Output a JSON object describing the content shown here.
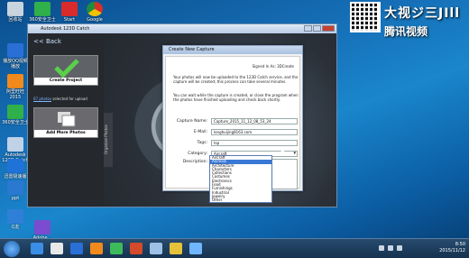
{
  "desktop": {
    "icons": [
      {
        "label": "回收站",
        "color": "#c9d4de"
      },
      {
        "label": "360安全卫士",
        "color": "#2fb04a"
      },
      {
        "label": "Start",
        "color": "#d92b2b"
      },
      {
        "label": "Google",
        "color": "#f2c200"
      },
      {
        "label": "播放QQ视频播放",
        "color": "#2a6fd6"
      },
      {
        "label": "阿里旺旺2015",
        "color": "#f08a1c"
      },
      {
        "label": "360安全卫士",
        "color": "#2fb04a"
      },
      {
        "label": "Autodesk 123D Catch",
        "color": "#c0d2e6"
      },
      {
        "label": "迅雷极速版",
        "color": "#1f73d8"
      },
      {
        "label": "ppt",
        "color": "#2a78d0"
      },
      {
        "label": "Q友",
        "color": "#2f7fd8"
      },
      {
        "label": "Adobe...",
        "color": "#7b4bd0"
      }
    ]
  },
  "brand": {
    "line1": "大视ジ三JIll",
    "line2": "腾讯视频"
  },
  "app": {
    "title": "Autodesk 123D Catch",
    "back_label": "<< Back",
    "tile1_label": "Create Project",
    "tile2_label": "Add More Photos",
    "photos_note_count": "67 photos",
    "photos_note_rest": "selected for upload",
    "organize_tab": "Organize Photos",
    "bg_text": "ESC"
  },
  "dialog": {
    "title": "Create New Capture",
    "signed_in": "Signed In As: 3DCreate",
    "para1": "Your photos will now be uploaded to the 123D Catch service, and the capture will be created; this process can take several minutes.",
    "para2": "You can wait while the capture is created, or close the program when the photos have finished uploading and check back shortly.",
    "fields": {
      "capture_name_label": "Capture Name:",
      "capture_name_value": "Capture_2015_11_12_08_53_24",
      "email_label": "E-Mail:",
      "email_value": "longhuijing8163.com",
      "tags_label": "Tags:",
      "tags_value": "tsp",
      "category_label": "Category:",
      "category_value": "Aircraft",
      "description_label": "Description:"
    },
    "category_options": [
      "Aircraft",
      "Animals",
      "Architecture",
      "Characters",
      "Collections",
      "Costumes",
      "Electronics",
      "Food",
      "Furnishings",
      "Industrial",
      "Jewelry",
      "Other"
    ],
    "highlighted_option_index": 1
  },
  "taskbar": {
    "apps": [
      {
        "color": "#3a8ee6"
      },
      {
        "color": "#e8e8e8"
      },
      {
        "color": "#2a6fd6"
      },
      {
        "color": "#f08a1c"
      },
      {
        "color": "#3dbb5a"
      },
      {
        "color": "#d44a2a"
      },
      {
        "color": "#9ec0e6"
      },
      {
        "color": "#e6c23a"
      },
      {
        "color": "#6fb6ff"
      }
    ],
    "time": "8:50",
    "date": "2015/11/12"
  }
}
